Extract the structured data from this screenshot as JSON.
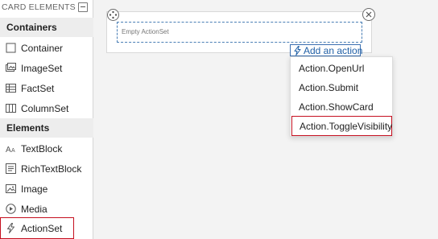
{
  "panel": {
    "header": "CARD ELEMENTS",
    "sections": {
      "containers": "Containers",
      "elements": "Elements"
    },
    "containers": [
      {
        "label": "Container",
        "icon": "container-icon"
      },
      {
        "label": "ImageSet",
        "icon": "imageset-icon"
      },
      {
        "label": "FactSet",
        "icon": "factset-icon"
      },
      {
        "label": "ColumnSet",
        "icon": "columnset-icon"
      }
    ],
    "elements": [
      {
        "label": "TextBlock",
        "icon": "textblock-icon"
      },
      {
        "label": "RichTextBlock",
        "icon": "richtextblock-icon"
      },
      {
        "label": "Image",
        "icon": "image-icon"
      },
      {
        "label": "Media",
        "icon": "media-icon"
      },
      {
        "label": "ActionSet",
        "icon": "lightning-icon",
        "selected": true
      }
    ]
  },
  "canvas": {
    "actionset_placeholder": "Empty ActionSet",
    "add_action_label": "Add an action"
  },
  "menu": {
    "items": [
      {
        "label": "Action.OpenUrl"
      },
      {
        "label": "Action.Submit"
      },
      {
        "label": "Action.ShowCard"
      },
      {
        "label": "Action.ToggleVisibility",
        "highlighted": true
      }
    ]
  },
  "colors": {
    "accent": "#1f5fa6",
    "highlight_border": "#c50f1f",
    "section_bg": "#ededed",
    "canvas_bg": "#f3f3f3"
  }
}
